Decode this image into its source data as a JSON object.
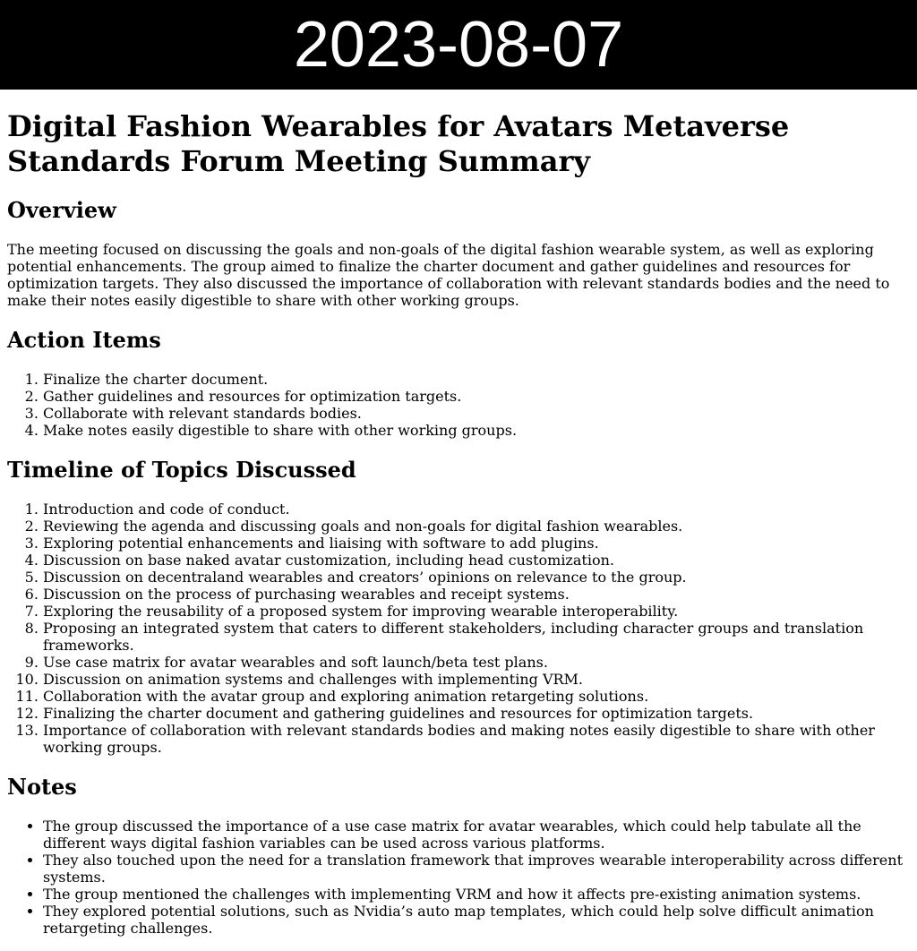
{
  "banner": {
    "date": "2023-08-07"
  },
  "title": "Digital Fashion Wearables for Avatars Metaverse Standards Forum Meeting Summary",
  "overview": {
    "heading": "Overview",
    "text": "The meeting focused on discussing the goals and non-goals of the digital fashion wearable system, as well as exploring potential enhancements. The group aimed to finalize the charter document and gather guidelines and resources for optimization targets. They also discussed the importance of collaboration with relevant standards bodies and the need to make their notes easily digestible to share with other working groups."
  },
  "action_items": {
    "heading": "Action Items",
    "items": [
      "Finalize the charter document.",
      "Gather guidelines and resources for optimization targets.",
      "Collaborate with relevant standards bodies.",
      "Make notes easily digestible to share with other working groups."
    ]
  },
  "timeline": {
    "heading": "Timeline of Topics Discussed",
    "items": [
      "Introduction and code of conduct.",
      "Reviewing the agenda and discussing goals and non-goals for digital fashion wearables.",
      "Exploring potential enhancements and liaising with software to add plugins.",
      "Discussion on base naked avatar customization, including head customization.",
      "Discussion on decentraland wearables and creators’ opinions on relevance to the group.",
      "Discussion on the process of purchasing wearables and receipt systems.",
      "Exploring the reusability of a proposed system for improving wearable interoperability.",
      "Proposing an integrated system that caters to different stakeholders, including character groups and translation frameworks.",
      "Use case matrix for avatar wearables and soft launch/beta test plans.",
      "Discussion on animation systems and challenges with implementing VRM.",
      "Collaboration with the avatar group and exploring animation retargeting solutions.",
      "Finalizing the charter document and gathering guidelines and resources for optimization targets.",
      "Importance of collaboration with relevant standards bodies and making notes easily digestible to share with other working groups."
    ]
  },
  "notes": {
    "heading": "Notes",
    "items": [
      "The group discussed the importance of a use case matrix for avatar wearables, which could help tabulate all the different ways digital fashion variables can be used across various platforms.",
      "They also touched upon the need for a translation framework that improves wearable interoperability across different systems.",
      "The group mentioned the challenges with implementing VRM and how it affects pre-existing animation systems.",
      "They explored potential solutions, such as Nvidia’s auto map templates, which could help solve difficult animation retargeting challenges."
    ]
  }
}
